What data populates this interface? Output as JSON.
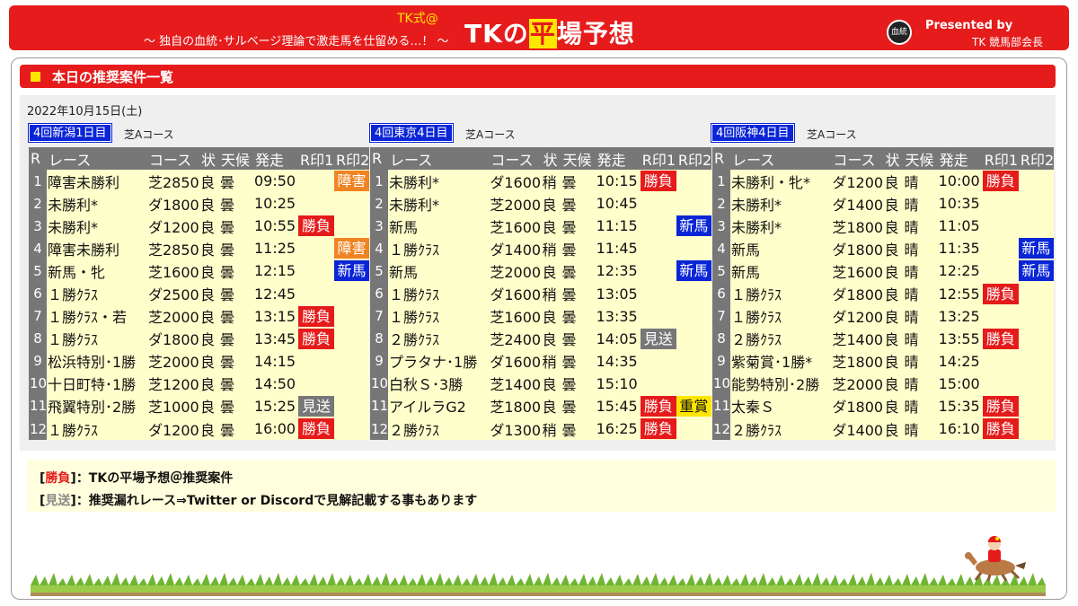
{
  "header": {
    "brand": "TK式@",
    "subtitle": "～ 独自の血統･サルベージ理論で激走馬を仕留める…！ ～",
    "title_pre": "TKの",
    "title_hi": "平",
    "title_post": "場予想",
    "logo_text": "血統",
    "presented_by": "Presented by",
    "president": "TK 競馬部会長"
  },
  "section": {
    "title": "本日の推奨案件一覧"
  },
  "date": "2022年10月15日(土)",
  "columns": [
    "R",
    "レース",
    "コース",
    "状",
    "天候",
    "発走",
    "R印1",
    "R印2"
  ],
  "meets": [
    {
      "name": "4回新潟1日目",
      "course_note": "芝Aコース",
      "races": [
        {
          "r": "1",
          "name": "障害未勝利",
          "course": "芝2850",
          "turf": true,
          "cond": "良",
          "weather": "曇",
          "time": "09:50",
          "m1": "",
          "m1c": "",
          "m2": "障害",
          "m2c": "orange"
        },
        {
          "r": "2",
          "name": "未勝利*",
          "course": "ダ1800",
          "turf": false,
          "cond": "良",
          "weather": "曇",
          "time": "10:25",
          "m1": "",
          "m1c": "",
          "m2": "",
          "m2c": ""
        },
        {
          "r": "3",
          "name": "未勝利*",
          "course": "ダ1200",
          "turf": false,
          "cond": "良",
          "weather": "曇",
          "time": "10:55",
          "m1": "勝負",
          "m1c": "red",
          "m2": "",
          "m2c": ""
        },
        {
          "r": "4",
          "name": "障害未勝利",
          "course": "芝2850",
          "turf": true,
          "cond": "良",
          "weather": "曇",
          "time": "11:25",
          "m1": "",
          "m1c": "",
          "m2": "障害",
          "m2c": "orange"
        },
        {
          "r": "5",
          "name": "新馬・牝",
          "course": "芝1600",
          "turf": true,
          "cond": "良",
          "weather": "曇",
          "time": "12:15",
          "m1": "",
          "m1c": "",
          "m2": "新馬",
          "m2c": "blue"
        },
        {
          "r": "6",
          "name": "１勝ｸﾗｽ",
          "course": "ダ2500",
          "turf": false,
          "cond": "良",
          "weather": "曇",
          "time": "12:45",
          "m1": "",
          "m1c": "",
          "m2": "",
          "m2c": ""
        },
        {
          "r": "7",
          "name": "１勝ｸﾗｽ・若",
          "course": "芝2000",
          "turf": true,
          "cond": "良",
          "weather": "曇",
          "time": "13:15",
          "m1": "勝負",
          "m1c": "red",
          "m2": "",
          "m2c": ""
        },
        {
          "r": "8",
          "name": "１勝ｸﾗｽ",
          "course": "ダ1800",
          "turf": false,
          "cond": "良",
          "weather": "曇",
          "time": "13:45",
          "m1": "勝負",
          "m1c": "red",
          "m2": "",
          "m2c": ""
        },
        {
          "r": "9",
          "name": "松浜特別･1勝",
          "course": "芝2000",
          "turf": true,
          "cond": "良",
          "weather": "曇",
          "time": "14:15",
          "m1": "",
          "m1c": "",
          "m2": "",
          "m2c": ""
        },
        {
          "r": "10",
          "name": "十日町特･1勝",
          "course": "芝1200",
          "turf": true,
          "cond": "良",
          "weather": "曇",
          "time": "14:50",
          "m1": "",
          "m1c": "",
          "m2": "",
          "m2c": ""
        },
        {
          "r": "11",
          "name": "飛翼特別･2勝",
          "course": "芝1000",
          "turf": true,
          "cond": "良",
          "weather": "曇",
          "time": "15:25",
          "m1": "見送",
          "m1c": "gray",
          "m2": "",
          "m2c": ""
        },
        {
          "r": "12",
          "name": "１勝ｸﾗｽ",
          "course": "ダ1200",
          "turf": false,
          "cond": "良",
          "weather": "曇",
          "time": "16:00",
          "m1": "勝負",
          "m1c": "red",
          "m2": "",
          "m2c": ""
        }
      ]
    },
    {
      "name": "4回東京4日目",
      "course_note": "芝Aコース",
      "races": [
        {
          "r": "1",
          "name": "未勝利*",
          "course": "ダ1600",
          "turf": false,
          "cond": "稍",
          "weather": "曇",
          "time": "10:15",
          "m1": "勝負",
          "m1c": "red",
          "m2": "",
          "m2c": ""
        },
        {
          "r": "2",
          "name": "未勝利*",
          "course": "芝2000",
          "turf": true,
          "cond": "良",
          "weather": "曇",
          "time": "10:45",
          "m1": "",
          "m1c": "",
          "m2": "",
          "m2c": ""
        },
        {
          "r": "3",
          "name": "新馬",
          "course": "芝1600",
          "turf": true,
          "cond": "良",
          "weather": "曇",
          "time": "11:15",
          "m1": "",
          "m1c": "",
          "m2": "新馬",
          "m2c": "blue"
        },
        {
          "r": "4",
          "name": "１勝ｸﾗｽ",
          "course": "ダ1400",
          "turf": false,
          "cond": "稍",
          "weather": "曇",
          "time": "11:45",
          "m1": "",
          "m1c": "",
          "m2": "",
          "m2c": ""
        },
        {
          "r": "5",
          "name": "新馬",
          "course": "芝2000",
          "turf": true,
          "cond": "良",
          "weather": "曇",
          "time": "12:35",
          "m1": "",
          "m1c": "",
          "m2": "新馬",
          "m2c": "blue"
        },
        {
          "r": "6",
          "name": "１勝ｸﾗｽ",
          "course": "ダ1600",
          "turf": false,
          "cond": "稍",
          "weather": "曇",
          "time": "13:05",
          "m1": "",
          "m1c": "",
          "m2": "",
          "m2c": ""
        },
        {
          "r": "7",
          "name": "１勝ｸﾗｽ",
          "course": "芝1600",
          "turf": true,
          "cond": "良",
          "weather": "曇",
          "time": "13:35",
          "m1": "",
          "m1c": "",
          "m2": "",
          "m2c": ""
        },
        {
          "r": "8",
          "name": "２勝ｸﾗｽ",
          "course": "芝2400",
          "turf": true,
          "cond": "良",
          "weather": "曇",
          "time": "14:05",
          "m1": "見送",
          "m1c": "gray",
          "m2": "",
          "m2c": ""
        },
        {
          "r": "9",
          "name": "プラタナ･1勝",
          "course": "ダ1600",
          "turf": false,
          "cond": "稍",
          "weather": "曇",
          "time": "14:35",
          "m1": "",
          "m1c": "",
          "m2": "",
          "m2c": ""
        },
        {
          "r": "10",
          "name": "白秋Ｓ･3勝",
          "course": "芝1400",
          "turf": true,
          "cond": "良",
          "weather": "曇",
          "time": "15:10",
          "m1": "",
          "m1c": "",
          "m2": "",
          "m2c": ""
        },
        {
          "r": "11",
          "name": "アイルラG2",
          "course": "芝1800",
          "turf": true,
          "cond": "良",
          "weather": "曇",
          "time": "15:45",
          "m1": "勝負",
          "m1c": "red",
          "m2": "重賞",
          "m2c": "yellow"
        },
        {
          "r": "12",
          "name": "２勝ｸﾗｽ",
          "course": "ダ1300",
          "turf": false,
          "cond": "稍",
          "weather": "曇",
          "time": "16:25",
          "m1": "勝負",
          "m1c": "red",
          "m2": "",
          "m2c": ""
        }
      ]
    },
    {
      "name": "4回阪神4日目",
      "course_note": "芝Aコース",
      "races": [
        {
          "r": "1",
          "name": "未勝利・牝*",
          "course": "ダ1200",
          "turf": false,
          "cond": "良",
          "weather": "晴",
          "time": "10:00",
          "m1": "勝負",
          "m1c": "red",
          "m2": "",
          "m2c": ""
        },
        {
          "r": "2",
          "name": "未勝利*",
          "course": "ダ1400",
          "turf": false,
          "cond": "良",
          "weather": "晴",
          "time": "10:35",
          "m1": "",
          "m1c": "",
          "m2": "",
          "m2c": ""
        },
        {
          "r": "3",
          "name": "未勝利*",
          "course": "芝1800",
          "turf": true,
          "cond": "良",
          "weather": "晴",
          "time": "11:05",
          "m1": "",
          "m1c": "",
          "m2": "",
          "m2c": ""
        },
        {
          "r": "4",
          "name": "新馬",
          "course": "ダ1800",
          "turf": false,
          "cond": "良",
          "weather": "晴",
          "time": "11:35",
          "m1": "",
          "m1c": "",
          "m2": "新馬",
          "m2c": "blue"
        },
        {
          "r": "5",
          "name": "新馬",
          "course": "芝1600",
          "turf": true,
          "cond": "良",
          "weather": "晴",
          "time": "12:25",
          "m1": "",
          "m1c": "",
          "m2": "新馬",
          "m2c": "blue"
        },
        {
          "r": "6",
          "name": "１勝ｸﾗｽ",
          "course": "ダ1800",
          "turf": false,
          "cond": "良",
          "weather": "晴",
          "time": "12:55",
          "m1": "勝負",
          "m1c": "red",
          "m2": "",
          "m2c": ""
        },
        {
          "r": "7",
          "name": "１勝ｸﾗｽ",
          "course": "ダ1200",
          "turf": false,
          "cond": "良",
          "weather": "晴",
          "time": "13:25",
          "m1": "",
          "m1c": "",
          "m2": "",
          "m2c": ""
        },
        {
          "r": "8",
          "name": "２勝ｸﾗｽ",
          "course": "芝1400",
          "turf": true,
          "cond": "良",
          "weather": "晴",
          "time": "13:55",
          "m1": "勝負",
          "m1c": "red",
          "m2": "",
          "m2c": ""
        },
        {
          "r": "9",
          "name": "紫菊賞･1勝*",
          "course": "芝1800",
          "turf": true,
          "cond": "良",
          "weather": "晴",
          "time": "14:25",
          "m1": "",
          "m1c": "",
          "m2": "",
          "m2c": ""
        },
        {
          "r": "10",
          "name": "能勢特別･2勝",
          "course": "芝2000",
          "turf": true,
          "cond": "良",
          "weather": "晴",
          "time": "15:00",
          "m1": "",
          "m1c": "",
          "m2": "",
          "m2c": ""
        },
        {
          "r": "11",
          "name": "太秦Ｓ",
          "course": "ダ1800",
          "turf": false,
          "cond": "良",
          "weather": "晴",
          "time": "15:35",
          "m1": "勝負",
          "m1c": "red",
          "m2": "",
          "m2c": ""
        },
        {
          "r": "12",
          "name": "２勝ｸﾗｽ",
          "course": "ダ1400",
          "turf": false,
          "cond": "良",
          "weather": "晴",
          "time": "16:10",
          "m1": "勝負",
          "m1c": "red",
          "m2": "",
          "m2c": ""
        }
      ]
    }
  ],
  "legend": {
    "line1_label": "勝負",
    "line1_text": "：TKの平場予想＠推奨案件",
    "line2_label": "見送",
    "line2_text": "：推奨漏れレース⇒Twitter or Discordで見解記載する事もあります"
  },
  "colors": {
    "red": "#e51b1b",
    "blue": "#0a25d6",
    "orange": "#f08322",
    "gray": "#777777",
    "yellow": "#ffe600",
    "cell": "#ffffcc"
  }
}
